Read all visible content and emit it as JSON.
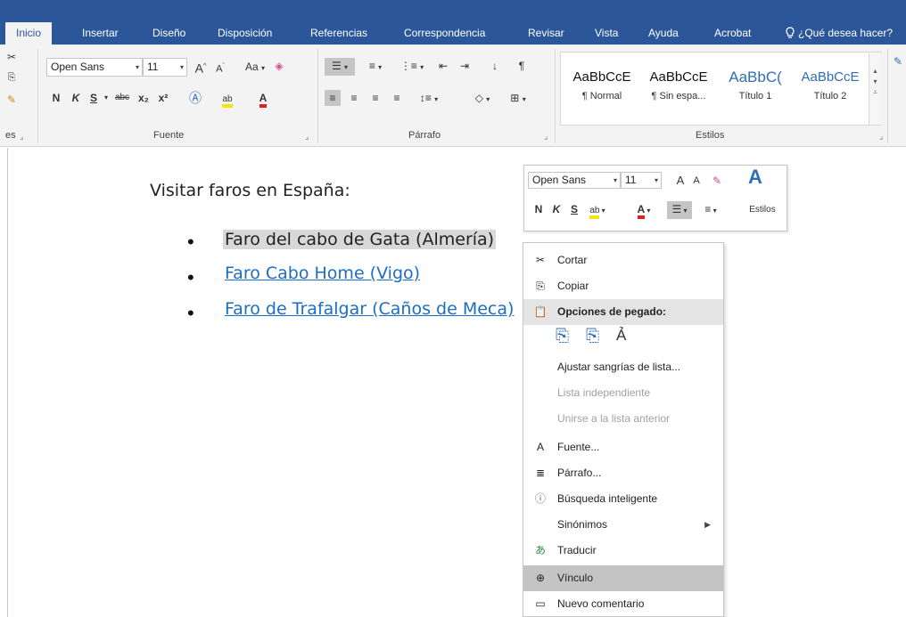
{
  "tabs": {
    "items": [
      {
        "label": "Inicio",
        "active": true
      },
      {
        "label": "Insertar"
      },
      {
        "label": "Diseño"
      },
      {
        "label": "Disposición"
      },
      {
        "label": "Referencias"
      },
      {
        "label": "Correspondencia"
      },
      {
        "label": "Revisar"
      },
      {
        "label": "Vista"
      },
      {
        "label": "Ayuda"
      },
      {
        "label": "Acrobat"
      }
    ],
    "tell_me": "¿Qué desea hacer?"
  },
  "ribbon": {
    "clipboard_label": "es",
    "font": {
      "name": "Open Sans",
      "size": "11",
      "group_label": "Fuente",
      "bold": "N",
      "italic": "K",
      "underline": "S",
      "strike": "abc",
      "subscript": "x₂",
      "superscript": "x²",
      "case": "Aa",
      "grow": "A",
      "shrink": "A"
    },
    "paragraph": {
      "group_label": "Párrafo",
      "pilcrow": "¶"
    },
    "styles": {
      "group_label": "Estilos",
      "items": [
        {
          "sample": "AaBbCcE",
          "name": "¶ Normal"
        },
        {
          "sample": "AaBbCcE",
          "name": "¶ Sin espa..."
        },
        {
          "sample": "AaBbC(",
          "name": "Título 1"
        },
        {
          "sample": "AaBbCcE",
          "name": "Título 2"
        }
      ]
    }
  },
  "document": {
    "heading": "Visitar faros en España:",
    "list": [
      {
        "text": "Faro del cabo de Gata (Almería)",
        "selected": true,
        "link": false
      },
      {
        "text": "Faro Cabo Home (Vigo)",
        "selected": false,
        "link": true
      },
      {
        "text": "Faro de Trafalgar (Caños de Meca)",
        "selected": false,
        "link": true
      }
    ]
  },
  "mini_toolbar": {
    "font": "Open Sans",
    "size": "11",
    "bold": "N",
    "italic": "K",
    "underline": "S",
    "styles_label": "Estilos"
  },
  "context_menu": {
    "items": [
      {
        "label": "Cortar",
        "icon": "scissors-icon"
      },
      {
        "label": "Copiar",
        "icon": "copy-icon"
      },
      {
        "label": "Opciones de pegado:",
        "icon": "paste-icon"
      },
      {
        "label": "Ajustar sangrías de lista..."
      },
      {
        "label": "Lista independiente",
        "disabled": true
      },
      {
        "label": "Unirse a la lista anterior",
        "disabled": true
      },
      {
        "label": "Fuente...",
        "icon": "font-icon"
      },
      {
        "label": "Párrafo...",
        "icon": "paragraph-icon"
      },
      {
        "label": "Búsqueda inteligente",
        "icon": "smart-lookup-icon"
      },
      {
        "label": "Sinónimos",
        "has_submenu": true
      },
      {
        "label": "Traducir",
        "icon": "translate-icon"
      },
      {
        "label": "Vínculo",
        "icon": "link-icon",
        "highlighted": true
      },
      {
        "label": "Nuevo comentario",
        "icon": "comment-icon"
      }
    ],
    "font_icon_glyph": "A"
  },
  "colors": {
    "tab_bar": "#2b579a",
    "ribbon": "#f3f3f3",
    "link": "#1b6ec2",
    "selection": "#d8d8d8",
    "menu_highlight": "#c4c4c4"
  }
}
